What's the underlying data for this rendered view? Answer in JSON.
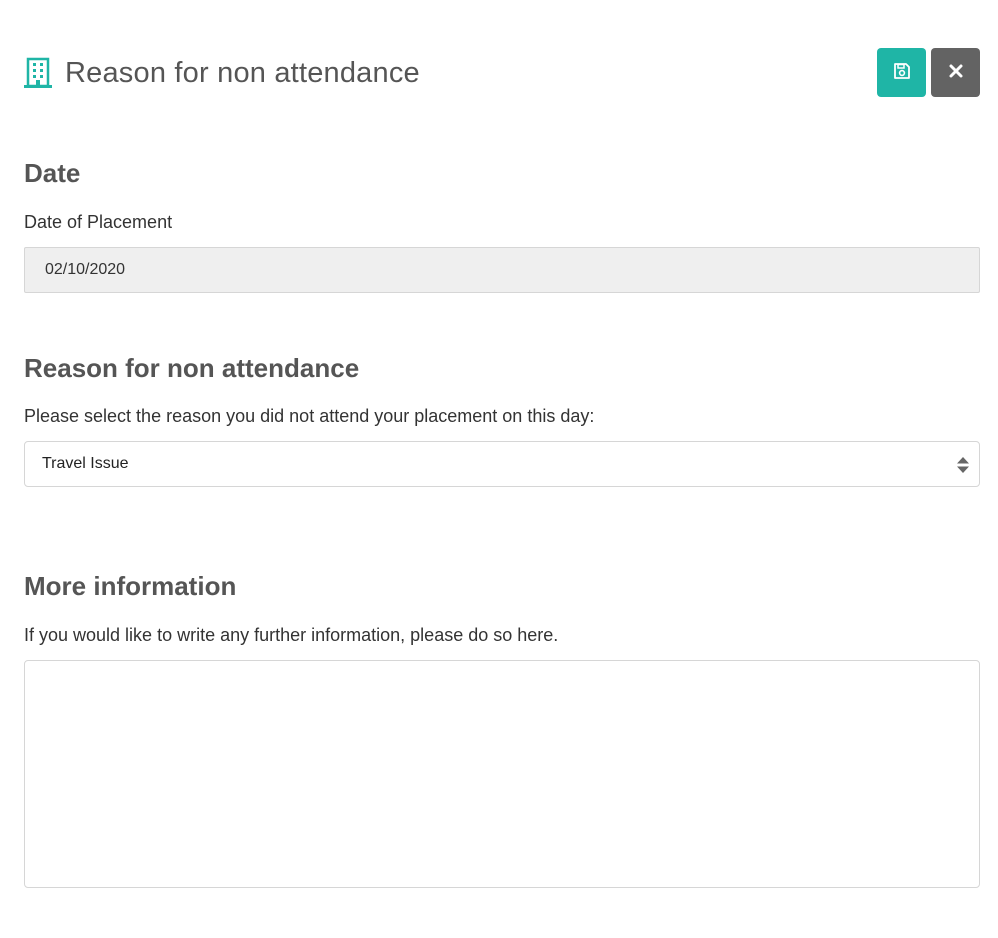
{
  "header": {
    "title": "Reason for non attendance",
    "icon": "building-icon",
    "accent_color": "#1fb5a6",
    "save_button_icon": "save-icon",
    "close_button_icon": "close-icon"
  },
  "date_section": {
    "heading": "Date",
    "label": "Date of Placement",
    "value": "02/10/2020"
  },
  "reason_section": {
    "heading": "Reason for non attendance",
    "label": "Please select the reason you did not attend your placement on this day:",
    "selected": "Travel Issue"
  },
  "info_section": {
    "heading": "More information",
    "label": "If you would like to write any further information, please do so here.",
    "value": ""
  }
}
